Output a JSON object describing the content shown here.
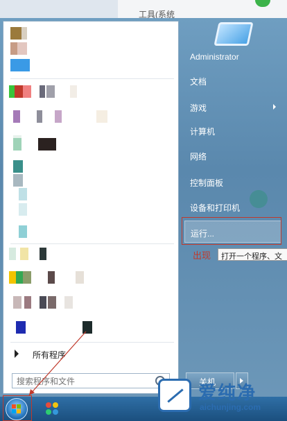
{
  "background_window": {
    "title_fragment": "工具(系统"
  },
  "start_menu": {
    "all_programs_label": "所有程序",
    "search_placeholder": "搜索程序和文件",
    "right_items": [
      {
        "label": "Administrator",
        "has_submenu": false
      },
      {
        "label": "文档",
        "has_submenu": false
      },
      {
        "label": "游戏",
        "has_submenu": true
      },
      {
        "label": "计算机",
        "has_submenu": false
      },
      {
        "label": "网络",
        "has_submenu": false
      },
      {
        "label": "控制面板",
        "has_submenu": false
      },
      {
        "label": "设备和打印机",
        "has_submenu": false
      },
      {
        "label": "运行...",
        "has_submenu": false,
        "highlighted": true
      }
    ],
    "shutdown_label": "关机"
  },
  "annotation": {
    "note": "出现",
    "tooltip": "打开一个程序、文"
  },
  "watermark": {
    "name": "爱纯净",
    "url": "aichunjing.com"
  },
  "colors": {
    "menu_right": "#5a88ad",
    "highlight_border": "#c0392b",
    "taskbar": "#1b4f7e",
    "brand": "#2b6cb0"
  }
}
